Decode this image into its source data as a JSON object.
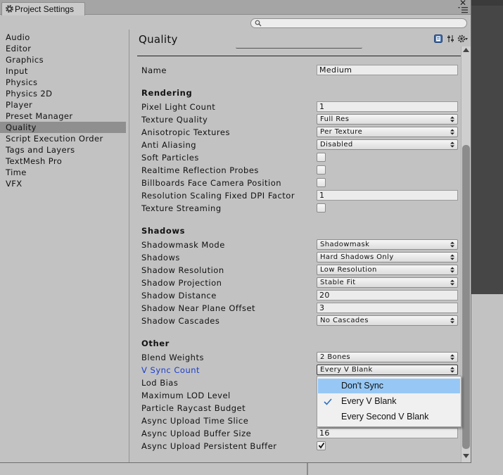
{
  "window": {
    "tab_title": "Project Settings"
  },
  "sidebar": {
    "items": [
      {
        "label": "Audio"
      },
      {
        "label": "Editor"
      },
      {
        "label": "Graphics"
      },
      {
        "label": "Input"
      },
      {
        "label": "Physics"
      },
      {
        "label": "Physics 2D"
      },
      {
        "label": "Player"
      },
      {
        "label": "Preset Manager"
      },
      {
        "label": "Quality",
        "selected": true
      },
      {
        "label": "Script Execution Order"
      },
      {
        "label": "Tags and Layers"
      },
      {
        "label": "TextMesh Pro"
      },
      {
        "label": "Time"
      },
      {
        "label": "VFX"
      }
    ]
  },
  "content": {
    "title": "Quality",
    "name": {
      "label": "Name",
      "value": "Medium"
    },
    "rendering": {
      "header": "Rendering",
      "pixel_light_count": {
        "label": "Pixel Light Count",
        "value": "1"
      },
      "texture_quality": {
        "label": "Texture Quality",
        "value": "Full Res"
      },
      "anisotropic_textures": {
        "label": "Anisotropic Textures",
        "value": "Per Texture"
      },
      "anti_aliasing": {
        "label": "Anti Aliasing",
        "value": "Disabled"
      },
      "soft_particles": {
        "label": "Soft Particles",
        "checked": false
      },
      "realtime_reflection_probes": {
        "label": "Realtime Reflection Probes",
        "checked": false
      },
      "billboards_face_camera": {
        "label": "Billboards Face Camera Position",
        "checked": false
      },
      "resolution_scaling_dpi": {
        "label": "Resolution Scaling Fixed DPI Factor",
        "value": "1"
      },
      "texture_streaming": {
        "label": "Texture Streaming",
        "checked": false
      }
    },
    "shadows": {
      "header": "Shadows",
      "shadowmask_mode": {
        "label": "Shadowmask Mode",
        "value": "Shadowmask"
      },
      "shadows": {
        "label": "Shadows",
        "value": "Hard Shadows Only"
      },
      "shadow_resolution": {
        "label": "Shadow Resolution",
        "value": "Low Resolution"
      },
      "shadow_projection": {
        "label": "Shadow Projection",
        "value": "Stable Fit"
      },
      "shadow_distance": {
        "label": "Shadow Distance",
        "value": "20"
      },
      "shadow_near_plane_offset": {
        "label": "Shadow Near Plane Offset",
        "value": "3"
      },
      "shadow_cascades": {
        "label": "Shadow Cascades",
        "value": "No Cascades"
      }
    },
    "other": {
      "header": "Other",
      "blend_weights": {
        "label": "Blend Weights",
        "value": "2 Bones"
      },
      "vsync_count": {
        "label": "V Sync Count",
        "value": "Every V Blank"
      },
      "lod_bias": {
        "label": "Lod Bias"
      },
      "max_lod_level": {
        "label": "Maximum LOD Level"
      },
      "particle_raycast_budget": {
        "label": "Particle Raycast Budget"
      },
      "async_upload_time_slice": {
        "label": "Async Upload Time Slice"
      },
      "async_upload_buffer_size": {
        "label": "Async Upload Buffer Size",
        "value": "16"
      },
      "async_upload_persistent_buffer": {
        "label": "Async Upload Persistent Buffer",
        "checked": true
      }
    }
  },
  "vsync_popup": {
    "options": [
      {
        "label": "Don't Sync",
        "hovered": true
      },
      {
        "label": "Every V Blank",
        "checked": true
      },
      {
        "label": "Every Second V Blank"
      }
    ]
  },
  "icons": [
    "settings-icon",
    "close-icon",
    "menu-icon",
    "search-icon",
    "help-icon",
    "preset-icon",
    "gear-icon",
    "dropdown-arrow-icon",
    "check-icon"
  ],
  "colors": {
    "active_label": "#1a3fcf",
    "selected_item": "#8f8f8f",
    "popup_hover": "#97c8f5"
  }
}
